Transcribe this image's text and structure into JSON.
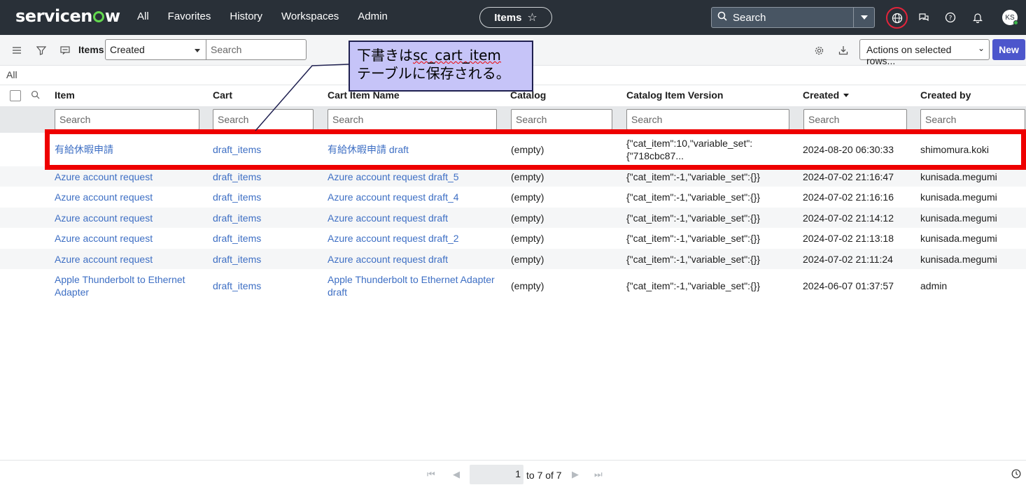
{
  "nav": {
    "logo_pre": "servicen",
    "logo_post": "w",
    "links": [
      "All",
      "Favorites",
      "History",
      "Workspaces",
      "Admin"
    ],
    "pill_label": "Items",
    "search_label": "Search",
    "avatar_initials": "KS"
  },
  "list": {
    "title": "Items",
    "field_select": "Created",
    "search_placeholder": "Search",
    "actions_label": "Actions on selected rows...",
    "new_label": "New",
    "breadcrumb": "All"
  },
  "columns": [
    "Item",
    "Cart",
    "Cart Item Name",
    "Catalog",
    "Catalog Item Version",
    "Created",
    "Created by"
  ],
  "column_search_placeholder": "Search",
  "rows": [
    {
      "item": "有給休暇申請",
      "cart": "draft_items",
      "name": "有給休暇申請 draft",
      "catalog": "(empty)",
      "version": "{\"cat_item\":10,\"variable_set\":{\"718cbc87...",
      "created": "2024-08-20 06:30:33",
      "by": "shimomura.koki"
    },
    {
      "item": "Azure account request",
      "cart": "draft_items",
      "name": "Azure account request draft_5",
      "catalog": "(empty)",
      "version": "{\"cat_item\":-1,\"variable_set\":{}}",
      "created": "2024-07-02 21:16:47",
      "by": "kunisada.megumi"
    },
    {
      "item": "Azure account request",
      "cart": "draft_items",
      "name": "Azure account request draft_4",
      "catalog": "(empty)",
      "version": "{\"cat_item\":-1,\"variable_set\":{}}",
      "created": "2024-07-02 21:16:16",
      "by": "kunisada.megumi"
    },
    {
      "item": "Azure account request",
      "cart": "draft_items",
      "name": "Azure account request draft",
      "catalog": "(empty)",
      "version": "{\"cat_item\":-1,\"variable_set\":{}}",
      "created": "2024-07-02 21:14:12",
      "by": "kunisada.megumi"
    },
    {
      "item": "Azure account request",
      "cart": "draft_items",
      "name": "Azure account request draft_2",
      "catalog": "(empty)",
      "version": "{\"cat_item\":-1,\"variable_set\":{}}",
      "created": "2024-07-02 21:13:18",
      "by": "kunisada.megumi"
    },
    {
      "item": "Azure account request",
      "cart": "draft_items",
      "name": "Azure account request draft",
      "catalog": "(empty)",
      "version": "{\"cat_item\":-1,\"variable_set\":{}}",
      "created": "2024-07-02 21:11:24",
      "by": "kunisada.megumi"
    },
    {
      "item": "Apple Thunderbolt to Ethernet Adapter",
      "cart": "draft_items",
      "name": "Apple Thunderbolt to Ethernet Adapter draft",
      "catalog": "(empty)",
      "version": "{\"cat_item\":-1,\"variable_set\":{}}",
      "created": "2024-06-07 01:37:57",
      "by": "admin"
    }
  ],
  "callout": {
    "line1_pre": "下書きは",
    "line1_code": "sc_cart_item",
    "line2": "テーブルに保存される。"
  },
  "pager": {
    "current": "1",
    "summary": "to 7 of 7"
  },
  "colors": {
    "nav_bg": "#293038",
    "link": "#3e6fc4",
    "new_button": "#4c56cc",
    "highlight": "#ee0000",
    "callout_bg": "#c6c4f8"
  }
}
